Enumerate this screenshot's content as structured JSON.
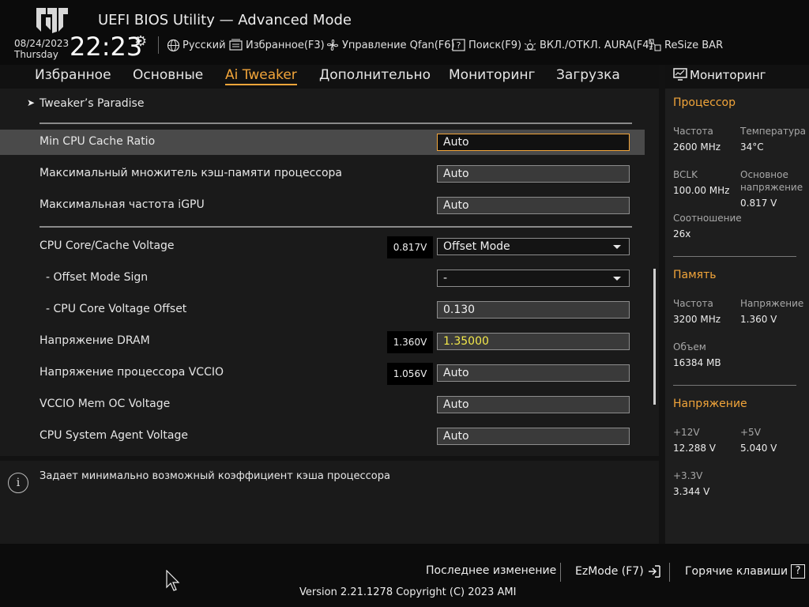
{
  "header": {
    "title": "UEFI BIOS Utility — Advanced Mode",
    "date": "08/24/2023",
    "weekday": "Thursday",
    "time": "22:23",
    "toolbar": [
      {
        "label": "Русский",
        "icon": "globe-icon"
      },
      {
        "label": "Избранное(F3)",
        "icon": "favorites-icon"
      },
      {
        "label": "Управление Qfan(F6)",
        "icon": "fan-icon"
      },
      {
        "label": "Поиск(F9)",
        "icon": "help-question-icon"
      },
      {
        "label": "ВКЛ./ОТКЛ. AURA(F4)",
        "icon": "aura-icon"
      },
      {
        "label": "ReSize BAR",
        "icon": "resize-bar-icon"
      }
    ]
  },
  "tabs": [
    "Избранное",
    "Основные",
    "Ai Tweaker",
    "Дополнительно",
    "Мониторинг",
    "Загрузка"
  ],
  "active_tab": "Ai Tweaker",
  "breadcrumb": "Tweaker’s Paradise",
  "settings": [
    {
      "label": "Min CPU Cache Ratio",
      "value": "Auto"
    },
    {
      "label": "Максимальный множитель кэш-памяти процессора",
      "value": "Auto"
    },
    {
      "label": "Максимальная частота iGPU",
      "value": "Auto"
    },
    {
      "label": "CPU Core/Cache Voltage",
      "voltage": "0.817V",
      "value": "Offset Mode"
    },
    {
      "label": "- Offset Mode Sign",
      "value": "-"
    },
    {
      "label": "- CPU Core Voltage Offset",
      "value": "0.130"
    },
    {
      "label": "Напряжение DRAM",
      "voltage": "1.360V",
      "value": "1.35000"
    },
    {
      "label": "Напряжение процессора VCCIO",
      "voltage": "1.056V",
      "value": "Auto"
    },
    {
      "label": "VCCIO Mem OC Voltage",
      "value": "Auto"
    },
    {
      "label": "CPU System Agent Voltage",
      "value": "Auto"
    }
  ],
  "help_text": "Задает минимально возможный коэффициент кэша процессора",
  "monitor": {
    "title": "Мониторинг",
    "cpu": {
      "heading": "Процессор",
      "freq_label": "Частота",
      "freq": "2600 MHz",
      "temp_label": "Температура",
      "temp": "34°C",
      "bclk_label": "BCLK",
      "bclk": "100.00 MHz",
      "vcore_label": "Основное напряжение",
      "vcore": "0.817 V",
      "ratio_label": "Соотношение",
      "ratio": "26x"
    },
    "memory": {
      "heading": "Память",
      "freq_label": "Частота",
      "freq": "3200 MHz",
      "volt_label": "Напряжение",
      "volt": "1.360 V",
      "size_label": "Объем",
      "size": "16384 MB"
    },
    "voltage": {
      "heading": "Напряжение",
      "v12_label": "+12V",
      "v12": "12.288 V",
      "v5_label": "+5V",
      "v5": "5.040 V",
      "v33_label": "+3.3V",
      "v33": "3.344 V"
    }
  },
  "footer": {
    "last_change": "Последнее изменение",
    "ezmode": "EzMode (F7)",
    "hotkeys": "Горячие клавиши",
    "version": "Version 2.21.1278 Copyright (C) 2023 AMI"
  },
  "colors": {
    "accent": "#f2a53a",
    "dram_value": "#f4e94a"
  }
}
